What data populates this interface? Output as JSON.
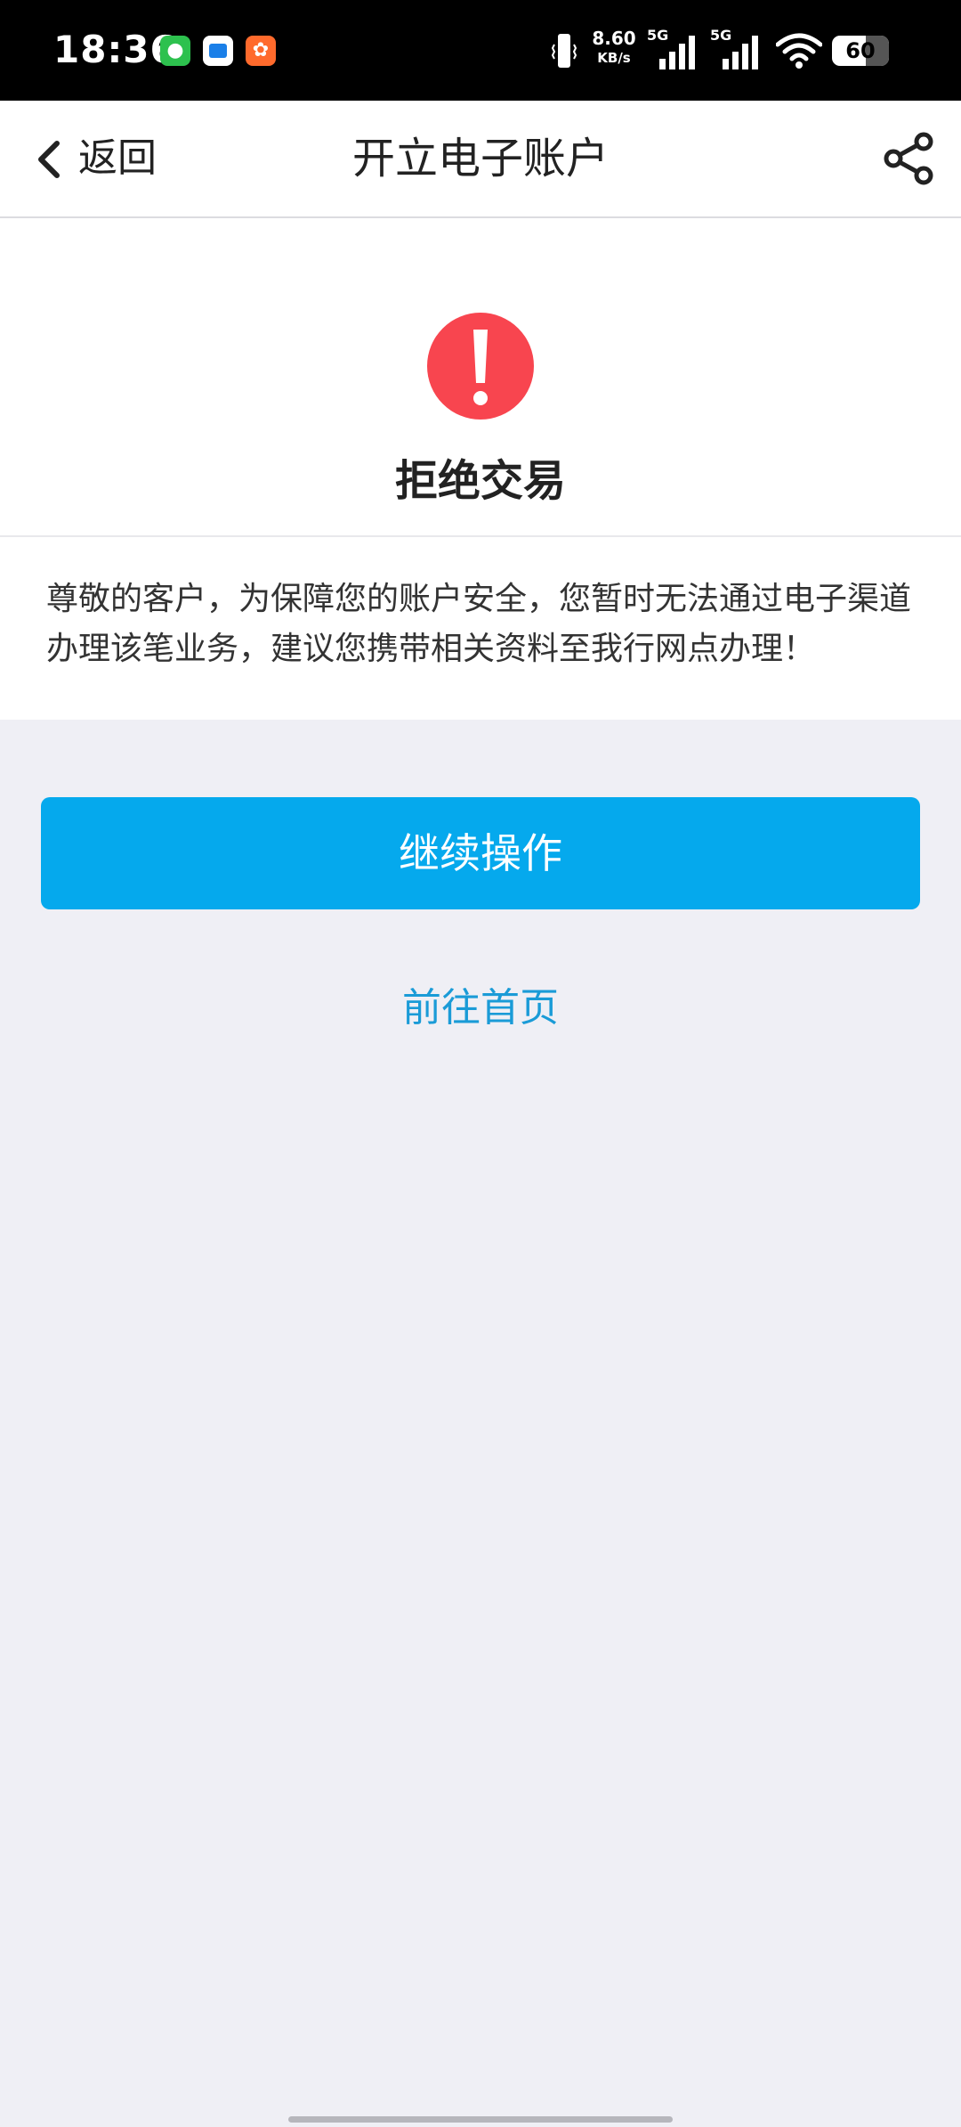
{
  "status_bar": {
    "time": "18:36",
    "net_speed_value": "8.60",
    "net_speed_unit": "KB/s",
    "signal1_label": "5G",
    "signal2_label": "5G",
    "battery_level": "60",
    "app_icons": [
      "wechat-icon",
      "app-blue-icon",
      "app-orange-icon"
    ]
  },
  "nav": {
    "back_label": "返回",
    "title": "开立电子账户",
    "share_icon": "share-icon"
  },
  "result": {
    "icon": "exclamation-alert-icon",
    "title": "拒绝交易",
    "message": "尊敬的客户，为保障您的账户安全，您暂时无法通过电子渠道办理该笔业务，建议您携带相关资料至我行网点办理！"
  },
  "actions": {
    "continue_label": "继续操作",
    "home_label": "前往首页"
  },
  "colors": {
    "primary_button": "#05a9ed",
    "link": "#1a9bd7",
    "alert": "#f8454f",
    "page_background": "#efeff5"
  }
}
